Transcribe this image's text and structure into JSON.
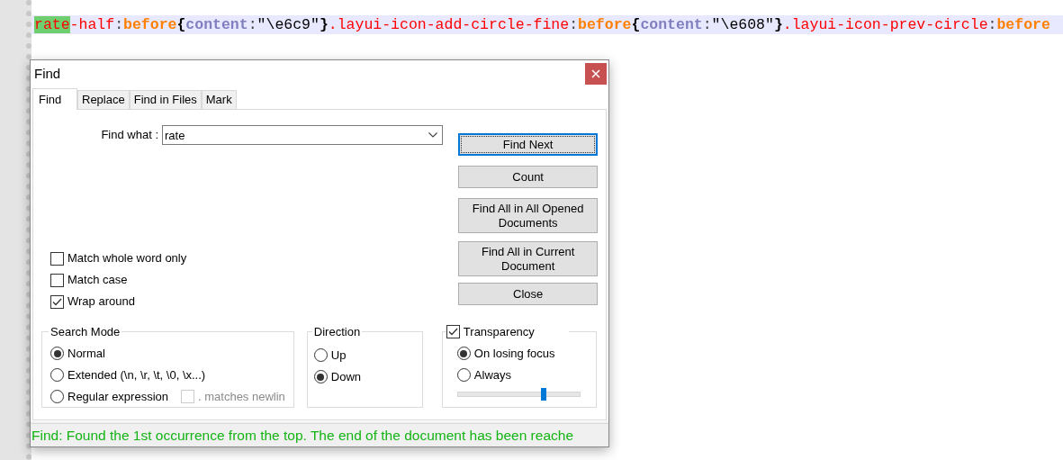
{
  "editor": {
    "tokens": [
      {
        "text": "rate",
        "kind": "match"
      },
      {
        "text": "-half",
        "kind": "selector"
      },
      {
        "text": ":",
        "kind": "punct"
      },
      {
        "text": "before",
        "kind": "pseudo"
      },
      {
        "text": "{",
        "kind": "brace"
      },
      {
        "text": "content",
        "kind": "property"
      },
      {
        "text": ":",
        "kind": "punct"
      },
      {
        "text": "\"\\e6c9\"",
        "kind": "string"
      },
      {
        "text": "}",
        "kind": "brace"
      },
      {
        "text": ".layui-icon-add-circle-fine",
        "kind": "selector"
      },
      {
        "text": ":",
        "kind": "punct"
      },
      {
        "text": "before",
        "kind": "pseudo"
      },
      {
        "text": "{",
        "kind": "brace"
      },
      {
        "text": "content",
        "kind": "property"
      },
      {
        "text": ":",
        "kind": "punct"
      },
      {
        "text": "\"\\e608\"",
        "kind": "string"
      },
      {
        "text": "}",
        "kind": "brace"
      },
      {
        "text": ".layui-icon-prev-circle",
        "kind": "selector"
      },
      {
        "text": ":",
        "kind": "punct"
      },
      {
        "text": "before",
        "kind": "pseudo"
      }
    ]
  },
  "dialog": {
    "title": "Find",
    "tabs": [
      {
        "label": "Find",
        "selected": true
      },
      {
        "label": "Replace",
        "selected": false
      },
      {
        "label": "Find in Files",
        "selected": false
      },
      {
        "label": "Mark",
        "selected": false
      }
    ],
    "find_what": {
      "label": "Find what :",
      "value": "rate"
    },
    "buttons": [
      {
        "label": "Find Next",
        "focused": true
      },
      {
        "label": "Count",
        "focused": false
      },
      {
        "label": "Find All in All Opened Documents",
        "focused": false
      },
      {
        "label": "Find All in Current Document",
        "focused": false
      },
      {
        "label": "Close",
        "focused": false
      }
    ],
    "options": [
      {
        "label": "Match whole word only",
        "checked": false
      },
      {
        "label": "Match case",
        "checked": false
      },
      {
        "label": "Wrap around",
        "checked": true
      }
    ],
    "search_mode": {
      "title": "Search Mode",
      "options": [
        {
          "label": "Normal",
          "selected": true
        },
        {
          "label": "Extended (\\n, \\r, \\t, \\0, \\x...)",
          "selected": false
        },
        {
          "label": "Regular expression",
          "selected": false
        }
      ],
      "newline_option": {
        "label": ". matches newlin",
        "checked": false,
        "disabled": true
      }
    },
    "direction": {
      "title": "Direction",
      "options": [
        {
          "label": "Up",
          "selected": false
        },
        {
          "label": "Down",
          "selected": true
        }
      ]
    },
    "transparency": {
      "label": "Transparency",
      "checked": true,
      "options": [
        {
          "label": "On losing focus",
          "selected": true
        },
        {
          "label": "Always",
          "selected": false
        }
      ],
      "level": 0.7
    },
    "status": "Find: Found the 1st occurrence from the top. The end of the document has been reache"
  }
}
